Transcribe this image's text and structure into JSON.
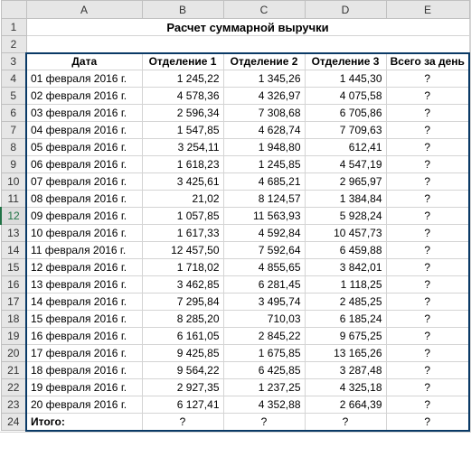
{
  "columns": [
    "A",
    "B",
    "C",
    "D",
    "E"
  ],
  "title": "Расчет суммарной выручки",
  "headers": {
    "date": "Дата",
    "d1": "Отделение 1",
    "d2": "Отделение 2",
    "d3": "Отделение 3",
    "total": "Всего за день"
  },
  "rows": [
    {
      "date": "01 февраля 2016 г.",
      "d1": "1 245,22",
      "d2": "1 345,26",
      "d3": "1 445,30",
      "total": "?"
    },
    {
      "date": "02 февраля 2016 г.",
      "d1": "4 578,36",
      "d2": "4 326,97",
      "d3": "4 075,58",
      "total": "?"
    },
    {
      "date": "03 февраля 2016 г.",
      "d1": "2 596,34",
      "d2": "7 308,68",
      "d3": "6 705,86",
      "total": "?"
    },
    {
      "date": "04 февраля 2016 г.",
      "d1": "1 547,85",
      "d2": "4 628,74",
      "d3": "7 709,63",
      "total": "?"
    },
    {
      "date": "05 февраля 2016 г.",
      "d1": "3 254,11",
      "d2": "1 948,80",
      "d3": "612,41",
      "total": "?"
    },
    {
      "date": "06 февраля 2016 г.",
      "d1": "1 618,23",
      "d2": "1 245,85",
      "d3": "4 547,19",
      "total": "?"
    },
    {
      "date": "07 февраля 2016 г.",
      "d1": "3 425,61",
      "d2": "4 685,21",
      "d3": "2 965,97",
      "total": "?"
    },
    {
      "date": "08 февраля 2016 г.",
      "d1": "21,02",
      "d2": "8 124,57",
      "d3": "1 384,84",
      "total": "?"
    },
    {
      "date": "09 февраля 2016 г.",
      "d1": "1 057,85",
      "d2": "11 563,93",
      "d3": "5 928,24",
      "total": "?"
    },
    {
      "date": "10 февраля 2016 г.",
      "d1": "1 617,33",
      "d2": "4 592,84",
      "d3": "10 457,73",
      "total": "?"
    },
    {
      "date": "11 февраля 2016 г.",
      "d1": "12 457,50",
      "d2": "7 592,64",
      "d3": "6 459,88",
      "total": "?"
    },
    {
      "date": "12 февраля 2016 г.",
      "d1": "1 718,02",
      "d2": "4 855,65",
      "d3": "3 842,01",
      "total": "?"
    },
    {
      "date": "13 февраля 2016 г.",
      "d1": "3 462,85",
      "d2": "6 281,45",
      "d3": "1 118,25",
      "total": "?"
    },
    {
      "date": "14 февраля 2016 г.",
      "d1": "7 295,84",
      "d2": "3 495,74",
      "d3": "2 485,25",
      "total": "?"
    },
    {
      "date": "15 февраля 2016 г.",
      "d1": "8 285,20",
      "d2": "710,03",
      "d3": "6 185,24",
      "total": "?"
    },
    {
      "date": "16 февраля 2016 г.",
      "d1": "6 161,05",
      "d2": "2 845,22",
      "d3": "9 675,25",
      "total": "?"
    },
    {
      "date": "17 февраля 2016 г.",
      "d1": "9 425,85",
      "d2": "1 675,85",
      "d3": "13 165,26",
      "total": "?"
    },
    {
      "date": "18 февраля 2016 г.",
      "d1": "9 564,22",
      "d2": "6 425,85",
      "d3": "3 287,48",
      "total": "?"
    },
    {
      "date": "19 февраля 2016 г.",
      "d1": "2 927,35",
      "d2": "1 237,25",
      "d3": "4 325,18",
      "total": "?"
    },
    {
      "date": "20 февраля 2016 г.",
      "d1": "6 127,41",
      "d2": "4 352,88",
      "d3": "2 664,39",
      "total": "?"
    }
  ],
  "footer": {
    "label": "Итого:",
    "d1": "?",
    "d2": "?",
    "d3": "?",
    "total": "?"
  },
  "selected_row_header": 12,
  "chart_data": {
    "type": "table",
    "title": "Расчет суммарной выручки",
    "columns": [
      "Дата",
      "Отделение 1",
      "Отделение 2",
      "Отделение 3",
      "Всего за день"
    ]
  }
}
